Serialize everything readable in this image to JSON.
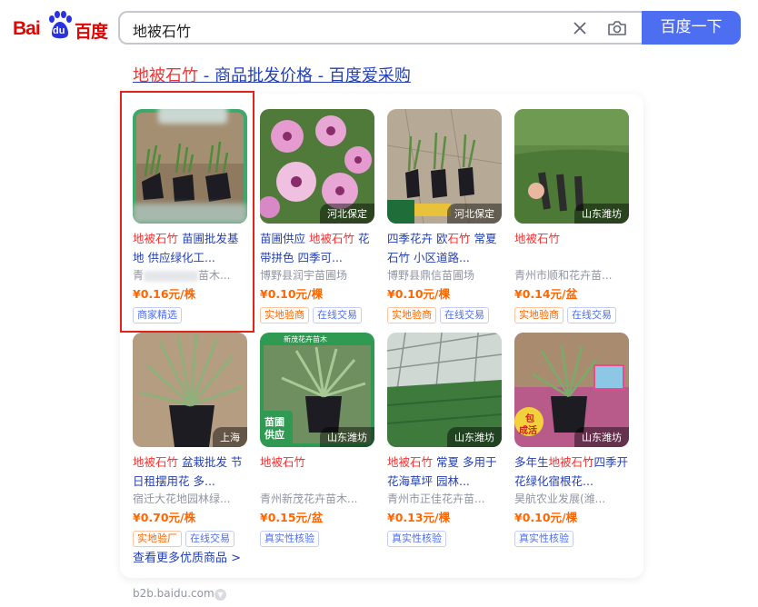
{
  "logo": {
    "bai": "Bai",
    "du": "du",
    "cn": "百度"
  },
  "search": {
    "query": "地被石竹",
    "button": "百度一下"
  },
  "result": {
    "title_hl": "地被石竹",
    "title_rest": " - 商品批发价格 - 百度爱采购"
  },
  "items": [
    {
      "name_hl": "地被石竹",
      "name_rest": " 苗圃批发基地 供应绿化工...",
      "shop": "青",
      "shop_rest": "苗木...",
      "price": "¥0.16元/株",
      "location": "",
      "tags": [
        "商家精选"
      ],
      "tag_styles": [
        "b"
      ]
    },
    {
      "name_pre": "地被石竹",
      "name_rest": " 花带拼色 四季可...",
      "shop": "博野县润宇苗圃场",
      "price": "¥0.10元/棵",
      "location": "河北保定",
      "tags": [
        "实地验商",
        "在线交易"
      ],
      "tag_styles": [
        "o",
        "b"
      ]
    },
    {
      "name_pre": "四季花卉 欧",
      "name_hl": "石竹",
      "name_rest": " 常夏石竹 小区道路...",
      "shop": "博野县鼎信苗圃场",
      "price": "¥0.10元/棵",
      "location": "河北保定",
      "tags": [
        "实地验商",
        "在线交易"
      ],
      "tag_styles": [
        "o",
        "b"
      ]
    },
    {
      "name_hl": "地被石竹",
      "name_rest": "",
      "shop": "青州市顺和花卉苗...",
      "price": "¥0.14元/盆",
      "location": "山东潍坊",
      "tags": [
        "实地验商",
        "在线交易"
      ],
      "tag_styles": [
        "o",
        "b"
      ]
    },
    {
      "name_hl": "地被石竹",
      "name_rest": " 盆栽批发 节日租摆用花 多...",
      "shop": "宿迁大花地园林绿...",
      "price": "¥0.70元/株",
      "location": "上海",
      "tags": [
        "实地验厂",
        "在线交易"
      ],
      "tag_styles": [
        "o",
        "b"
      ]
    },
    {
      "name_hl": "地被石竹",
      "name_rest": "",
      "shop": "青州新茂花卉苗木...",
      "price": "¥0.15元/盆",
      "location": "山东潍坊",
      "tags": [
        "真实性核验"
      ],
      "tag_styles": [
        "b"
      ]
    },
    {
      "name_hl": "地被石竹",
      "name_rest": " 常夏 多用于花海草坪 园林...",
      "shop": "青州市正佳花卉苗...",
      "price": "¥0.13元/棵",
      "location": "山东潍坊",
      "tags": [
        "真实性核验"
      ],
      "tag_styles": [
        "b"
      ]
    },
    {
      "name_pre": "多年生",
      "name_hl": "地被石竹",
      "name_rest": "四季开花绿化宿根花...",
      "shop": "昊航农业发展(潍...",
      "price": "¥0.10元/棵",
      "location": "山东潍坊",
      "tags": [
        "真实性核验"
      ],
      "tag_styles": [
        "b"
      ]
    }
  ],
  "img_text": {
    "i2": "花",
    "i6": "新茂花卉苗木",
    "i6b": "苗圃",
    "i6c": "供应",
    "i8": "包",
    "i8b": "成活"
  },
  "item1_name": "地被石竹 花",
  "item2_name": "四季花卉 欧石竹 常夏",
  "more": "查看更多优质商品 >",
  "footer": {
    "url": "b2b.baidu.com"
  },
  "colors": {
    "link": "#2440b3",
    "highlight": "#f73131",
    "price": "#ff6600",
    "button": "#4e6ef2"
  }
}
